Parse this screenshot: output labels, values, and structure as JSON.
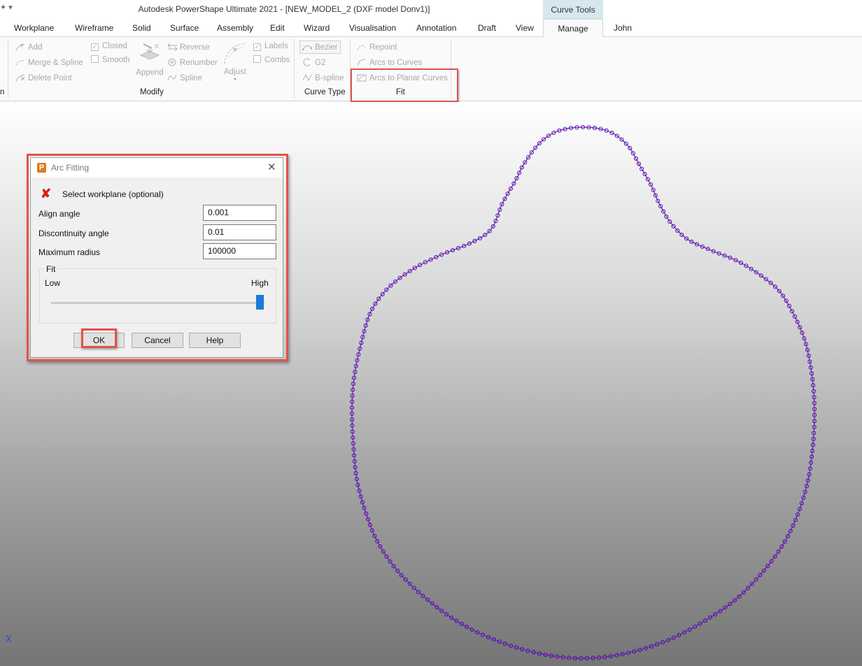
{
  "window": {
    "title": "Autodesk PowerShape Ultimate 2021 - [NEW_MODEL_2 (DXF model Donv1)]",
    "contextual_tab": "Curve Tools"
  },
  "tabs": [
    "Workplane",
    "Wireframe",
    "Solid",
    "Surface",
    "Assembly",
    "Edit",
    "Wizard",
    "Visualisation",
    "Annotation",
    "Draft",
    "View",
    "Manage",
    "John"
  ],
  "active_tab": "Manage",
  "ribbon": {
    "cut_group_fragment": "n",
    "edit": {
      "add": "Add",
      "merge_spline": "Merge & Spline",
      "delete_point": "Delete Point"
    },
    "toggles": {
      "closed": "Closed",
      "smooth": "Smooth"
    },
    "append": "Append",
    "modify": {
      "reverse": "Reverse",
      "renumber": "Renumber",
      "spline": "Spline"
    },
    "adjust": "Adjust",
    "display": {
      "labels": "Labels",
      "combs": "Combs"
    },
    "modify_group": "Modify",
    "curve_type": {
      "bezier": "Bezier",
      "g2": "G2",
      "bspline": "B-spline",
      "group": "Curve Type"
    },
    "fit": {
      "repoint": "Repoint",
      "arcs_to_curves": "Arcs to Curves",
      "arcs_to_planar": "Arcs to Planar Curves",
      "group": "Fit"
    }
  },
  "dialog": {
    "title": "Arc Fitting",
    "select_workplane": "Select workplane (optional)",
    "align_angle_label": "Align angle",
    "align_angle": "0.001",
    "discontinuity_label": "Discontinuity angle",
    "discontinuity": "0.01",
    "max_radius_label": "Maximum radius",
    "max_radius": "100000",
    "fit_label": "Fit",
    "fit_low": "Low",
    "fit_high": "High",
    "fit_level": 1.0,
    "ok": "OK",
    "cancel": "Cancel",
    "help": "Help"
  },
  "viewport": {
    "axis_label": "X",
    "curve_color": "#c000c0",
    "point_color": "#1a1aa8"
  }
}
